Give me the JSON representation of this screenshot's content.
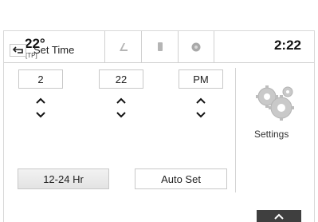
{
  "status": {
    "temperature": "22°",
    "temperature_sub": "[TP]",
    "clock": "2:22"
  },
  "header": {
    "title": "Set Time"
  },
  "time": {
    "hour": "2",
    "minute": "22",
    "period": "PM"
  },
  "buttons": {
    "format": "12-24 Hr",
    "auto_set": "Auto Set"
  },
  "settings": {
    "label": "Settings"
  },
  "icons": {
    "tab1": "music-note-icon",
    "tab2": "phone-icon",
    "tab3": "navigation-icon",
    "back": "back-arrow-icon",
    "up": "chevron-up-icon",
    "down": "chevron-down-icon",
    "settings": "gears-icon",
    "expand": "chevron-up-icon"
  }
}
